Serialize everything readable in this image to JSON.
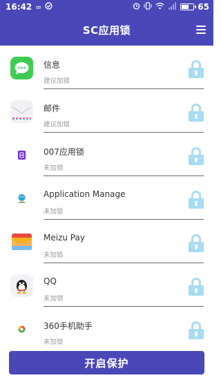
{
  "status_bar": {
    "time": "16:42",
    "battery_level": "65",
    "battery_fraction": 0.65,
    "icons": [
      "infinity-icon",
      "check-circle-icon",
      "alarm-icon",
      "vibrate-icon",
      "wifi-icon",
      "signal-icon",
      "battery-icon"
    ]
  },
  "app_bar": {
    "title": "SC应用锁",
    "menu_icon": "hamburger-menu-icon"
  },
  "apps": [
    {
      "name": "信息",
      "status": "建议加锁",
      "icon": "messages-app-icon",
      "locked": false
    },
    {
      "name": "邮件",
      "status": "建议加锁",
      "icon": "mail-app-icon",
      "locked": false
    },
    {
      "name": "007应用锁",
      "status": "未加锁",
      "icon": "app-lock-007-icon",
      "locked": false
    },
    {
      "name": "Application Manage",
      "status": "未加锁",
      "icon": "application-manage-icon",
      "locked": false
    },
    {
      "name": "Meizu Pay",
      "status": "未加锁",
      "icon": "meizu-pay-icon",
      "locked": false
    },
    {
      "name": "QQ",
      "status": "未加锁",
      "icon": "qq-app-icon",
      "locked": false
    },
    {
      "name": "360手机助手",
      "status": "未加锁",
      "icon": "360-assistant-icon",
      "locked": false
    }
  ],
  "bottom_button": {
    "label": "开启保护"
  },
  "colors": {
    "primary": "#4a48b8",
    "lock": "#a7dcf3",
    "status_text": "#9a9a9a"
  }
}
